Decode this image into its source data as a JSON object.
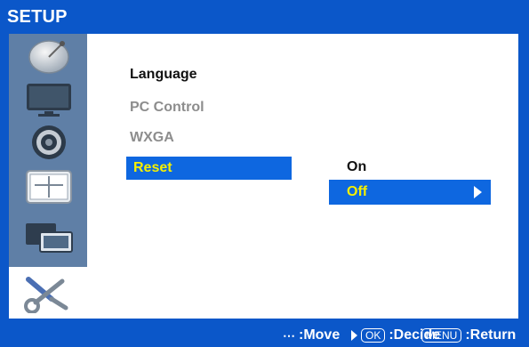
{
  "header": {
    "title": "SETUP"
  },
  "sidebar": {
    "items": [
      {
        "icon": "satellite-dish-icon"
      },
      {
        "icon": "display-icon"
      },
      {
        "icon": "speaker-icon"
      },
      {
        "icon": "timer-panel-icon"
      },
      {
        "icon": "monitor-stack-icon"
      },
      {
        "icon": "tools-icon"
      }
    ]
  },
  "menu": {
    "items": [
      {
        "label": "Language",
        "state": "normal"
      },
      {
        "label": "PC Control",
        "state": "dim"
      },
      {
        "label": "WXGA",
        "state": "dim"
      },
      {
        "label": "Reset",
        "state": "selected"
      }
    ],
    "submenu": {
      "on_label": "On",
      "off_label": "Off"
    }
  },
  "footer": {
    "move_label": ":Move",
    "ok_key": "OK",
    "decide_label": ":Decide",
    "menu_key": "MENU",
    "return_label": ":Return"
  },
  "colors": {
    "frame_blue": "#0b57c9",
    "highlight_blue": "#0e67e0",
    "selected_text": "#f6f000",
    "sidebar_bg": "#5f7fa6",
    "dim_text": "#8d8d8d"
  }
}
